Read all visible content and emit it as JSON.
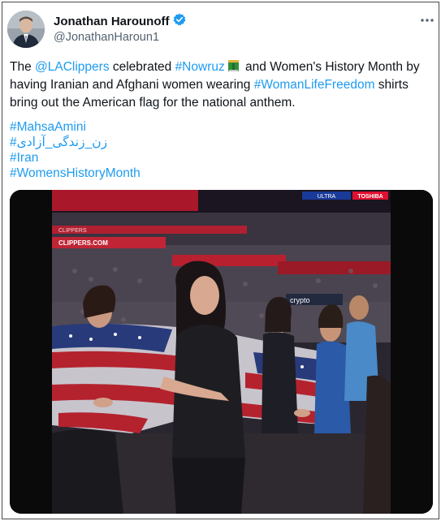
{
  "author": {
    "display_name": "Jonathan Harounoff",
    "handle": "@JonathanHaroun1",
    "verified": true
  },
  "tweet": {
    "p1": {
      "t1": "The ",
      "mention": "@LAClippers",
      "t2": " celebrated ",
      "hashtag1": "#Nowruz",
      "t3": " and Women's History Month by having Iranian and Afghani women wearing ",
      "hashtag2": "#WomanLifeFreedom",
      "t4": " shirts bring out the American flag for the national anthem."
    },
    "hashtags": [
      "#MahsaAmini",
      "#زن_زندگی_آزادی",
      "#Iran",
      "#WomensHistoryMonth"
    ]
  },
  "media": {
    "arena_banners": [
      "CLIPPERS.COM",
      "CLIPPERS",
      "crypto",
      "TOSHIBA",
      "ULTRA"
    ]
  },
  "colors": {
    "link": "#1d9bf0",
    "verified": "#1d9bf0",
    "secondary_text": "#536471"
  },
  "icons": [
    "verified-badge-icon",
    "more-options-icon",
    "book-emoji-icon"
  ]
}
